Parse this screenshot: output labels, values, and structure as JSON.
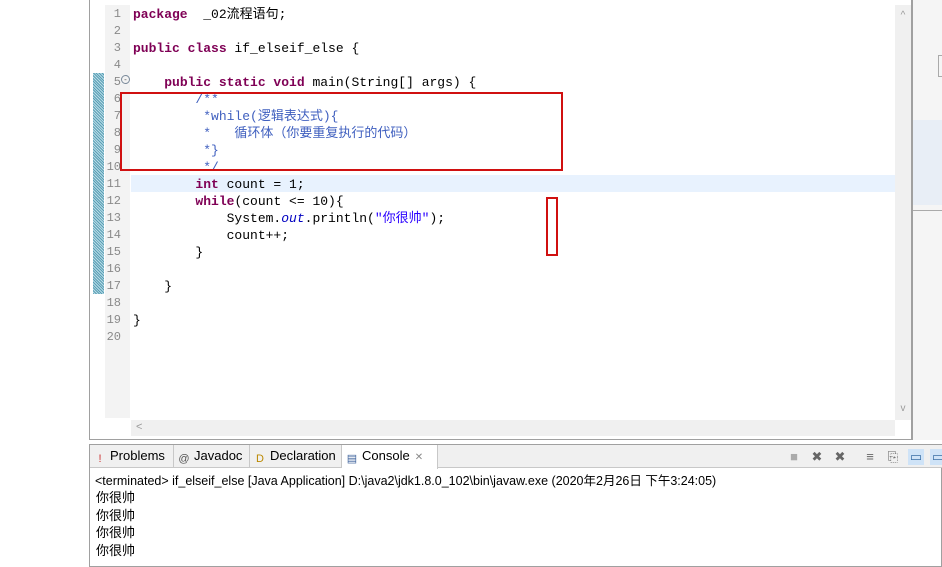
{
  "editor": {
    "line_numbers": [
      "1",
      "2",
      "3",
      "4",
      "5",
      "6",
      "7",
      "8",
      "9",
      "10",
      "11",
      "12",
      "13",
      "14",
      "15",
      "16",
      "17",
      "18",
      "19",
      "20"
    ],
    "lines": [
      [
        [
          "kw",
          "package"
        ],
        [
          "",
          "  _02流程语句;"
        ]
      ],
      [],
      [
        [
          "kw",
          "public"
        ],
        [
          "",
          ""
        ],
        [
          "",
          ""
        ],
        [
          "kw",
          " class"
        ],
        [
          "",
          " if_elseif_else {"
        ]
      ],
      [],
      [
        [
          "",
          "    "
        ],
        [
          "kw",
          "public static void"
        ],
        [
          "",
          " main(String[] "
        ],
        [
          "",
          "args) {"
        ]
      ],
      [
        [
          "",
          "        "
        ],
        [
          "cm",
          "/**"
        ]
      ],
      [
        [
          "",
          "         "
        ],
        [
          "cm",
          "*while(逻辑表达式){"
        ]
      ],
      [
        [
          "",
          "         "
        ],
        [
          "cm",
          "*   循环体（你要重复执行的代码）"
        ]
      ],
      [
        [
          "",
          "         "
        ],
        [
          "cm",
          "*}"
        ]
      ],
      [
        [
          "",
          "         "
        ],
        [
          "cm",
          "*/"
        ]
      ],
      [
        [
          "",
          "        "
        ],
        [
          "kw",
          "int"
        ],
        [
          "",
          " count = 1;"
        ]
      ],
      [
        [
          "",
          "        "
        ],
        [
          "kw",
          "while"
        ],
        [
          "",
          "(count <= 10){"
        ]
      ],
      [
        [
          "",
          "            System."
        ],
        [
          "fd",
          "out"
        ],
        [
          "",
          ".println("
        ],
        [
          "st",
          "\"你很帅\""
        ],
        [
          "",
          ");"
        ]
      ],
      [
        [
          "",
          "            count++;"
        ]
      ],
      [
        [
          "",
          "        }"
        ]
      ],
      [],
      [
        [
          "",
          "    }"
        ]
      ],
      [],
      [
        [
          "",
          "}"
        ]
      ],
      []
    ],
    "scroll_left_label": "<",
    "scroll_up_label": "^",
    "scroll_down_label": "v"
  },
  "console": {
    "tabs": [
      {
        "label": "Problems",
        "icon": "problems-icon",
        "glyph": "!"
      },
      {
        "label": "Javadoc",
        "icon": "javadoc-icon",
        "glyph": "@"
      },
      {
        "label": "Declaration",
        "icon": "declaration-icon",
        "glyph": "D"
      },
      {
        "label": "Console",
        "icon": "console-icon",
        "glyph": "▤",
        "active": true,
        "close": "✕"
      }
    ],
    "status": "<terminated> if_elseif_else [Java Application] D:\\java2\\jdk1.8.0_102\\bin\\javaw.exe (2020年2月26日 下午3:24:05)",
    "output": [
      "你很帅",
      "你很帅",
      "你很帅",
      "你很帅"
    ],
    "toolbar": [
      {
        "name": "terminate-icon",
        "glyph": "■"
      },
      {
        "name": "remove-launch-icon",
        "glyph": "✖"
      },
      {
        "name": "remove-all-icon",
        "glyph": "✖"
      },
      {
        "name": "scroll-lock-icon",
        "glyph": "≡"
      },
      {
        "name": "word-wrap-icon",
        "glyph": "⎘"
      },
      {
        "name": "pin-console-icon",
        "glyph": "▭"
      },
      {
        "name": "display-console-icon",
        "glyph": "▭"
      }
    ]
  },
  "colors": {
    "keyword": "#7f0055",
    "comment": "#3f5fbf",
    "string": "#2a00ff",
    "annotation_box": "#d01010",
    "current_line": "#e8f2fe"
  }
}
